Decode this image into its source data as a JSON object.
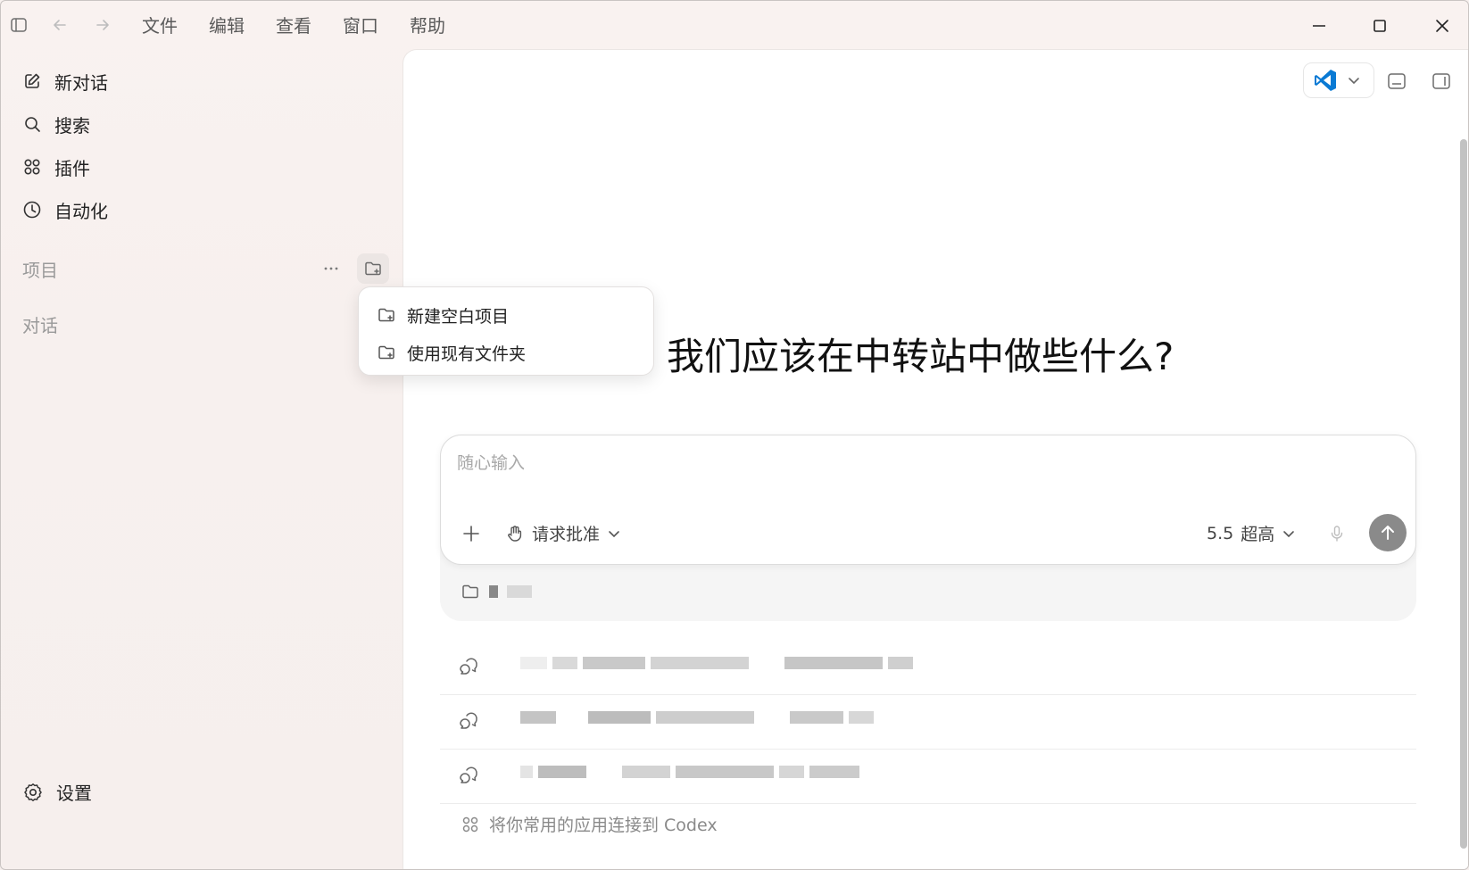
{
  "menu": [
    "文件",
    "编辑",
    "查看",
    "窗口",
    "帮助"
  ],
  "sidebar": {
    "items": [
      {
        "label": "新对话",
        "icon": "edit-icon"
      },
      {
        "label": "搜索",
        "icon": "search-icon"
      },
      {
        "label": "插件",
        "icon": "grid-icon"
      },
      {
        "label": "自动化",
        "icon": "clock-icon"
      }
    ],
    "projects_label": "项目",
    "conversations_label": "对话",
    "settings_label": "设置"
  },
  "dropdown": {
    "items": [
      {
        "label": "新建空白项目",
        "icon": "folder-plus-icon"
      },
      {
        "label": "使用现有文件夹",
        "icon": "folder-plus-icon"
      }
    ]
  },
  "main": {
    "headline": "我们应该在中转站中做些什么?",
    "composer": {
      "placeholder": "随心输入",
      "approval_label": "请求批准",
      "model_version": "5.5",
      "model_level": "超高"
    },
    "connect_text": "将你常用的应用连接到 Codex"
  },
  "colors": {
    "accent_vscode": "#0a7ad4",
    "send_button": "#8a8a8a",
    "background": "#f7f0ee"
  }
}
